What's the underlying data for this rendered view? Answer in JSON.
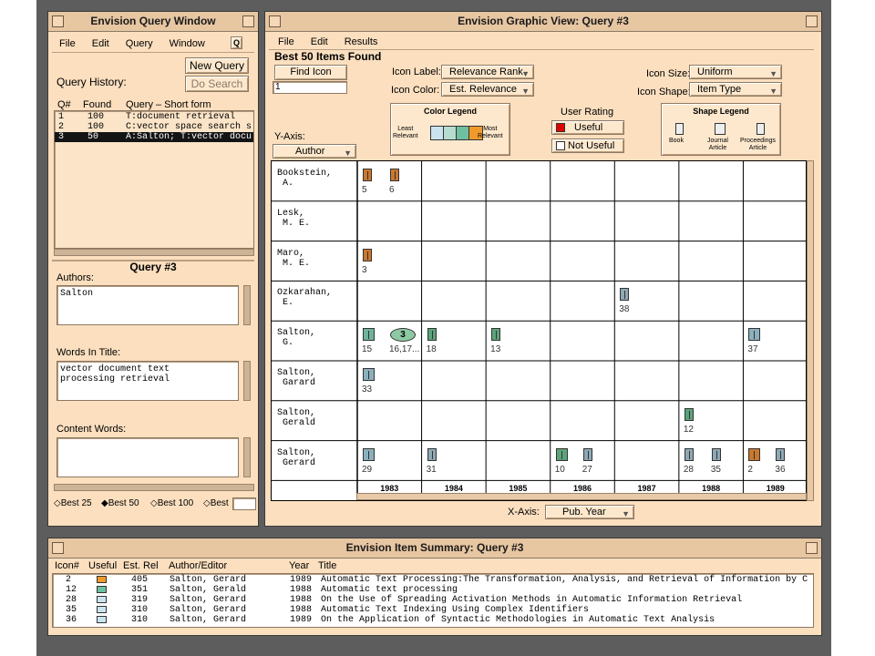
{
  "colors": {
    "book": "#c9782e",
    "journal": "#8ab0bd",
    "proceedings": "#8fa8b5",
    "green": "#5ba47a",
    "useful": "#e00000",
    "dark": "#141414"
  },
  "query_window": {
    "title": "Envision Query Window",
    "menu": [
      "File",
      "Edit",
      "Query",
      "Window"
    ],
    "menu_badge": "Q",
    "history_label": "Query History:",
    "new_query": "New Query",
    "do_search": "Do Search",
    "cols": [
      "Q#",
      "Found",
      "Query – Short form"
    ],
    "rows": [
      {
        "q": "1",
        "found": "100",
        "text": "T:document retrieval"
      },
      {
        "q": "2",
        "found": "100",
        "text": "C:vector space search s"
      },
      {
        "q": "3",
        "found": "50",
        "text": "A:Salton; T:vector docu"
      }
    ],
    "query_title": "Query #3",
    "authors_label": "Authors:",
    "authors_value": "Salton",
    "words_label": "Words In Title:",
    "words_value": "vector document text\nprocessing retrieval",
    "content_label": "Content Words:",
    "content_value": "",
    "best_options": [
      "Best 25",
      "Best 50",
      "Best 100",
      "Best"
    ],
    "best_selected": "Best 50"
  },
  "graphic_view": {
    "title": "Envision Graphic View: Query #3",
    "menu": [
      "File",
      "Edit",
      "Results"
    ],
    "heading": "Best 50 Items Found",
    "find_icon": "Find Icon",
    "find_value": "1",
    "icon_label_label": "Icon Label:",
    "icon_label_value": "Relevance Rank",
    "icon_color_label": "Icon Color:",
    "icon_color_value": "Est. Relevance",
    "icon_size_label": "Icon Size:",
    "icon_size_value": "Uniform",
    "icon_shape_label": "Icon Shape:",
    "icon_shape_value": "Item Type",
    "color_legend": {
      "title": "Color Legend",
      "least": "Least\nRelevant",
      "most": "Most\nRelevant",
      "swatches": [
        "#c9e4ef",
        "#b6dcd0",
        "#6fc0a0",
        "#f19a2c"
      ]
    },
    "user_rating": {
      "title": "User Rating",
      "useful": "Useful",
      "not_useful": "Not Useful"
    },
    "shape_legend": {
      "title": "Shape Legend",
      "items": [
        "Book",
        "Journal\nArticle",
        "Proceedings\nArticle"
      ]
    },
    "y_axis_label": "Y-Axis:",
    "y_axis_value": "Author",
    "x_axis_label": "X-Axis:",
    "x_axis_value": "Pub. Year",
    "years": [
      "1983",
      "1984",
      "1985",
      "1986",
      "1987",
      "1988",
      "1989"
    ],
    "authors": [
      "Bookstein,\n A.",
      "Lesk,\n M. E.",
      "Maro,\n M. E.",
      "Ozkarahan,\n E.",
      "Salton,\n G.",
      "Salton,\n Garard",
      "Salton,\n Gerald",
      "Salton,\n Gerard"
    ],
    "cells": [
      {
        "row": 0,
        "col": 0,
        "icons": [
          {
            "label": "5",
            "type": "book",
            "color": "#c9782e"
          },
          {
            "label": "6",
            "type": "book",
            "color": "#c9782e"
          }
        ]
      },
      {
        "row": 2,
        "col": 0,
        "icons": [
          {
            "label": "3",
            "type": "book",
            "color": "#c9782e"
          }
        ]
      },
      {
        "row": 3,
        "col": 4,
        "icons": [
          {
            "label": "38",
            "type": "proceedings",
            "color": "#8fa8b5"
          }
        ]
      },
      {
        "row": 4,
        "col": 0,
        "icons": [
          {
            "label": "15",
            "type": "journal",
            "color": "#6fb49a"
          },
          {
            "label": "16,17...",
            "type": "cluster",
            "color": "#8ec9a3",
            "count": "3"
          }
        ]
      },
      {
        "row": 4,
        "col": 1,
        "icons": [
          {
            "label": "18",
            "type": "proceedings",
            "color": "#5ba47a"
          }
        ]
      },
      {
        "row": 4,
        "col": 2,
        "icons": [
          {
            "label": "13",
            "type": "proceedings",
            "color": "#5ba47a"
          }
        ]
      },
      {
        "row": 4,
        "col": 6,
        "icons": [
          {
            "label": "37",
            "type": "journal",
            "color": "#8ab0bd"
          }
        ]
      },
      {
        "row": 5,
        "col": 0,
        "icons": [
          {
            "label": "33",
            "type": "journal",
            "color": "#8ab0bd"
          }
        ]
      },
      {
        "row": 6,
        "col": 5,
        "icons": [
          {
            "label": "12",
            "type": "book",
            "color": "#5ba47a"
          }
        ]
      },
      {
        "row": 7,
        "col": 0,
        "icons": [
          {
            "label": "29",
            "type": "journal",
            "color": "#8ab0bd"
          }
        ]
      },
      {
        "row": 7,
        "col": 1,
        "icons": [
          {
            "label": "31",
            "type": "proceedings",
            "color": "#8fa8b5"
          }
        ]
      },
      {
        "row": 7,
        "col": 3,
        "icons": [
          {
            "label": "10",
            "type": "journal",
            "color": "#5ba47a"
          },
          {
            "label": "27",
            "type": "proceedings",
            "color": "#8fa8b5"
          }
        ]
      },
      {
        "row": 7,
        "col": 5,
        "icons": [
          {
            "label": "28",
            "type": "proceedings",
            "color": "#8fa8b5"
          },
          {
            "label": "35",
            "type": "proceedings",
            "color": "#8fa8b5"
          }
        ]
      },
      {
        "row": 7,
        "col": 6,
        "icons": [
          {
            "label": "2",
            "type": "journal",
            "color": "#c9782e"
          },
          {
            "label": "36",
            "type": "proceedings",
            "color": "#8fa8b5"
          }
        ]
      }
    ]
  },
  "summary": {
    "title": "Envision Item Summary: Query #3",
    "cols": [
      "Icon#",
      "Useful",
      "Est. Rel",
      "Author/Editor",
      "Year",
      "Title"
    ],
    "rows": [
      {
        "icon": "2",
        "color": "#f19a2c",
        "rel": "405",
        "author": "Salton, Gerard",
        "year": "1989",
        "title": "Automatic Text Processing:The Transformation, Analysis, and Retrieval of Information by C"
      },
      {
        "icon": "12",
        "color": "#6fc0a0",
        "rel": "351",
        "author": "Salton, Gerald",
        "year": "1988",
        "title": "Automatic text processing"
      },
      {
        "icon": "28",
        "color": "#c9e4ef",
        "rel": "319",
        "author": "Salton, Gerard",
        "year": "1988",
        "title": "On the Use of Spreading Activation Methods in Automatic Information Retrieval"
      },
      {
        "icon": "35",
        "color": "#c9e4ef",
        "rel": "310",
        "author": "Salton, Gerard",
        "year": "1988",
        "title": "Automatic Text Indexing Using Complex Identifiers"
      },
      {
        "icon": "36",
        "color": "#c9e4ef",
        "rel": "310",
        "author": "Salton, Gerard",
        "year": "1989",
        "title": "On the Application of Syntactic Methodologies in Automatic Text Analysis"
      }
    ]
  }
}
